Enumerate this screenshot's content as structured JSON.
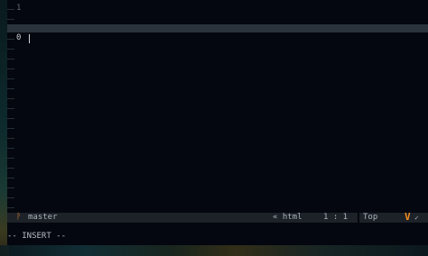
{
  "editor": {
    "mode": "INSERT",
    "faded_top_text": "·········",
    "lines": [
      {
        "number": "1",
        "text": ""
      },
      {
        "number": "0",
        "text": ""
      }
    ]
  },
  "statusline": {
    "branch_icon": "git-branch-icon",
    "branch": "master",
    "filetype": "« html",
    "position": "1 : 1",
    "scroll": "Top",
    "logo": "V",
    "check": "✓"
  },
  "modeline": {
    "text": "-- INSERT --"
  },
  "colors": {
    "background": "#04070f",
    "cursorline": "#2a323c",
    "statusline": "#1c2228",
    "accent": "#f08a1e"
  }
}
